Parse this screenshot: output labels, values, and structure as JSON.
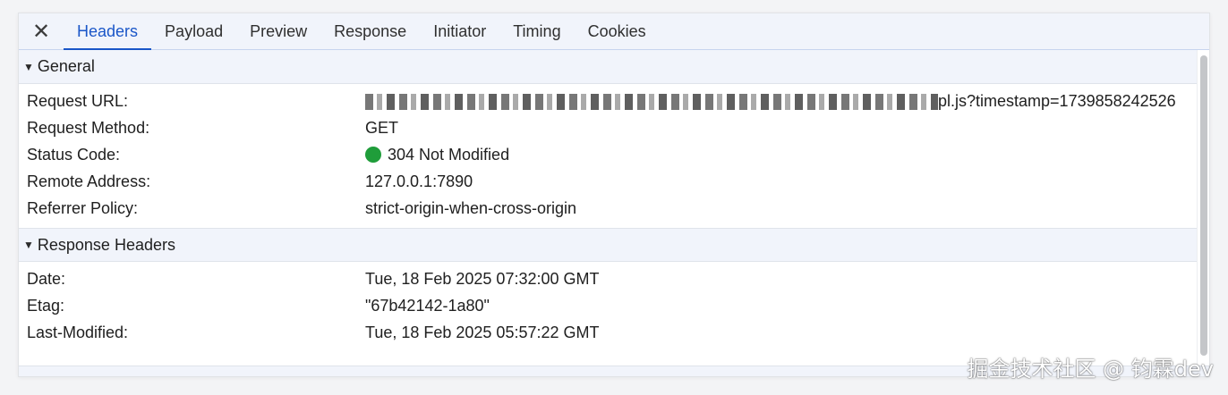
{
  "tabs": {
    "close_symbol": "✕",
    "items": [
      "Headers",
      "Payload",
      "Preview",
      "Response",
      "Initiator",
      "Timing",
      "Cookies"
    ],
    "active": "Headers"
  },
  "general": {
    "title": "General",
    "rows": [
      {
        "key": "Request URL:",
        "value_suffix": "pl.js?timestamp=1739858242526"
      },
      {
        "key": "Request Method:",
        "value": "GET"
      },
      {
        "key": "Status Code:",
        "value": "304 Not Modified",
        "status_color": "#1f9d3a"
      },
      {
        "key": "Remote Address:",
        "value": "127.0.0.1:7890"
      },
      {
        "key": "Referrer Policy:",
        "value": "strict-origin-when-cross-origin"
      }
    ]
  },
  "response_headers": {
    "title": "Response Headers",
    "rows": [
      {
        "key": "Date:",
        "value": "Tue, 18 Feb 2025 07:32:00 GMT"
      },
      {
        "key": "Etag:",
        "value": "\"67b42142-1a80\""
      },
      {
        "key": "Last-Modified:",
        "value": "Tue, 18 Feb 2025 05:57:22 GMT"
      }
    ]
  },
  "watermark": "掘金技术社区 @ 钧霖dev",
  "colors": {
    "accent": "#1a56c8",
    "tabbar_bg": "#f1f4fb",
    "status_ok": "#1f9d3a"
  }
}
